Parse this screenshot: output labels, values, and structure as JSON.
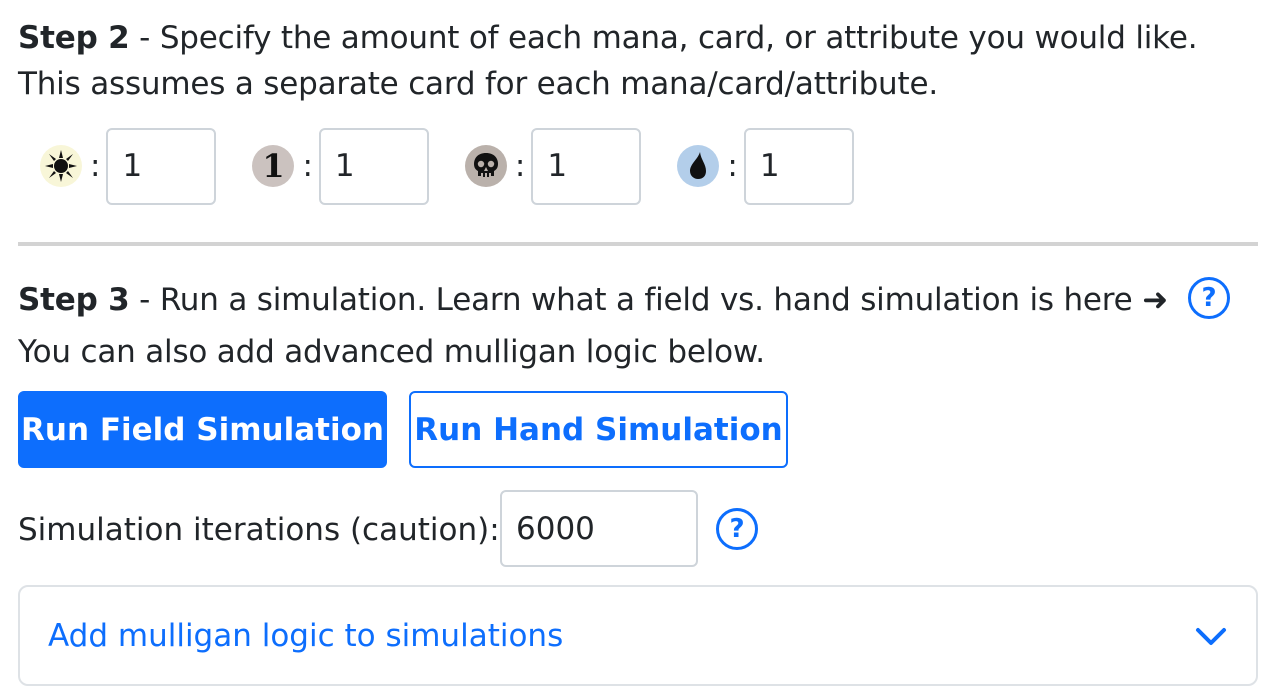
{
  "step2": {
    "title": "Step 2",
    "text": " - Specify the amount of each mana, card, or attribute you would like.",
    "line2": "This assumes a separate card for each mana/card/attribute.",
    "mana": [
      {
        "icon": "white-mana-sun-icon",
        "colon": ":",
        "value": "1"
      },
      {
        "icon": "generic-mana-one-icon",
        "colon": ":",
        "value": "1",
        "glyph": "1"
      },
      {
        "icon": "black-mana-skull-icon",
        "colon": ":",
        "value": "1"
      },
      {
        "icon": "blue-mana-drop-icon",
        "colon": ":",
        "value": "1"
      }
    ]
  },
  "step3": {
    "title": "Step 3",
    "text": " - Run a simulation. Learn what a field vs. hand simulation is here ",
    "arrow": "➜",
    "help": "?",
    "line2": "You can also add advanced mulligan logic below."
  },
  "buttons": {
    "field": "Run Field Simulation",
    "hand": "Run Hand Simulation"
  },
  "iterations": {
    "label": "Simulation iterations (caution):",
    "value": "6000",
    "help": "?"
  },
  "accordion": {
    "label": "Add mulligan logic to simulations",
    "icon": "chevron-down-icon"
  },
  "colors": {
    "accent": "#0d6efd",
    "white_mana": "#f8f6d8",
    "generic_mana": "#cbc2bf",
    "black_mana": "#bab1ab",
    "blue_mana": "#b3ceea"
  }
}
